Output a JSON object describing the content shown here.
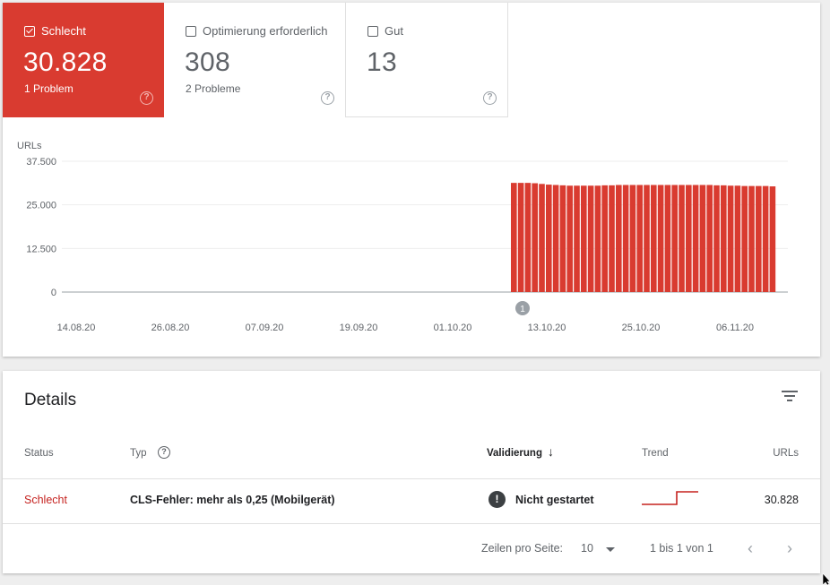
{
  "tiles": {
    "poor": {
      "label": "Schlecht",
      "value": "30.828",
      "sub": "1 Problem",
      "help": "?"
    },
    "needs": {
      "label": "Optimierung erforderlich",
      "value": "308",
      "sub": "2 Probleme",
      "help": "?"
    },
    "good": {
      "label": "Gut",
      "value": "13",
      "help": "?"
    }
  },
  "colors": {
    "poor": "#d93b30",
    "axis": "#5f6368",
    "grid": "#eeeeee"
  },
  "chart_data": {
    "type": "bar",
    "ylabel": "URLs",
    "ylim": [
      0,
      37500
    ],
    "yticks": [
      0,
      12500,
      25000,
      37500
    ],
    "ytick_labels": [
      "0",
      "12.500",
      "25.000",
      "37.500"
    ],
    "xtick_labels": [
      "14.08.20",
      "26.08.20",
      "07.09.20",
      "19.09.20",
      "01.10.20",
      "13.10.20",
      "25.10.20",
      "06.11.20"
    ],
    "annotation": "1",
    "series": [
      {
        "color": "#d93b30",
        "values": [
          31300,
          31300,
          31300,
          31200,
          31000,
          30800,
          30700,
          30600,
          30500,
          30500,
          30500,
          30500,
          30500,
          30600,
          30600,
          30700,
          30700,
          30700,
          30700,
          30700,
          30700,
          30700,
          30700,
          30700,
          30700,
          30700,
          30700,
          30700,
          30700,
          30600,
          30600,
          30500,
          30500,
          30400,
          30400,
          30400,
          30400,
          30300
        ]
      }
    ]
  },
  "details": {
    "title": "Details",
    "columns": {
      "status": "Status",
      "type": "Typ",
      "validation": "Validierung",
      "validation_sort": "↓",
      "trend": "Trend",
      "urls": "URLs"
    },
    "type_help": "?",
    "rows": [
      {
        "status": "Schlecht",
        "type": "CLS-Fehler: mehr als 0,25 (Mobilgerät)",
        "validation_icon": "!",
        "validation": "Nicht gestartet",
        "urls": "30.828"
      }
    ],
    "pager": {
      "rows_per_page_label": "Zeilen pro Seite:",
      "rows_per_page": "10",
      "range": "1 bis 1 von 1",
      "prev": "‹",
      "next": "›"
    }
  }
}
